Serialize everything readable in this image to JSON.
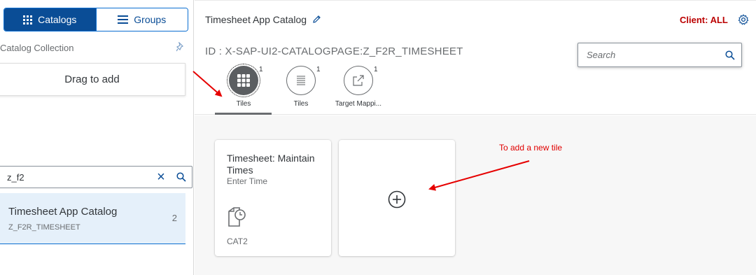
{
  "sidebar": {
    "segments": [
      {
        "label": "Catalogs",
        "icon": "grid-icon",
        "active": true
      },
      {
        "label": "Groups",
        "icon": "menu-icon",
        "active": false
      }
    ],
    "collection_title": "Catalog Collection",
    "drag_label": "Drag to add",
    "search_value": "z_f2",
    "list": [
      {
        "title": "Timesheet App Catalog",
        "subtitle": "Z_F2R_TIMESHEET",
        "count": "2"
      }
    ]
  },
  "header": {
    "title": "Timesheet App Catalog",
    "client": "Client: ALL",
    "id": "ID : X-SAP-UI2-CATALOGPAGE:Z_F2R_TIMESHEET",
    "search_placeholder": "Search"
  },
  "tabs": [
    {
      "label": "Tiles",
      "count": "1",
      "icon": "grid-icon",
      "selected": true
    },
    {
      "label": "Tiles",
      "count": "1",
      "icon": "list-icon",
      "selected": false
    },
    {
      "label": "Target Mappi...",
      "count": "1",
      "icon": "share-icon",
      "selected": false
    }
  ],
  "tiles": [
    {
      "title": "Timesheet: Maintain Times",
      "subtitle": "Enter Time",
      "icon": "time-document-icon",
      "footer": "CAT2"
    }
  ],
  "annotation": "To add a new tile",
  "colors": {
    "accent": "#0a4d96",
    "client": "#bb0000",
    "annotation": "#e00000"
  }
}
